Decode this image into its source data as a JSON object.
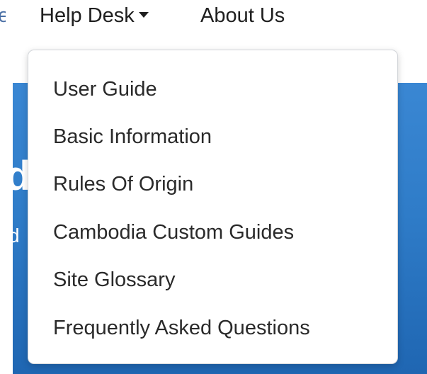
{
  "navbar": {
    "clipped_item_tail": "e",
    "help_desk_label": "Help Desk",
    "about_us_label": "About Us"
  },
  "hero": {
    "big_letter": "d",
    "small_letter": "d",
    "color": "#2f7cc8"
  },
  "dropdown": {
    "items": [
      {
        "label": "User Guide"
      },
      {
        "label": "Basic Information"
      },
      {
        "label": "Rules Of Origin"
      },
      {
        "label": "Cambodia Custom Guides"
      },
      {
        "label": "Site Glossary"
      },
      {
        "label": "Frequently Asked Questions"
      }
    ]
  }
}
